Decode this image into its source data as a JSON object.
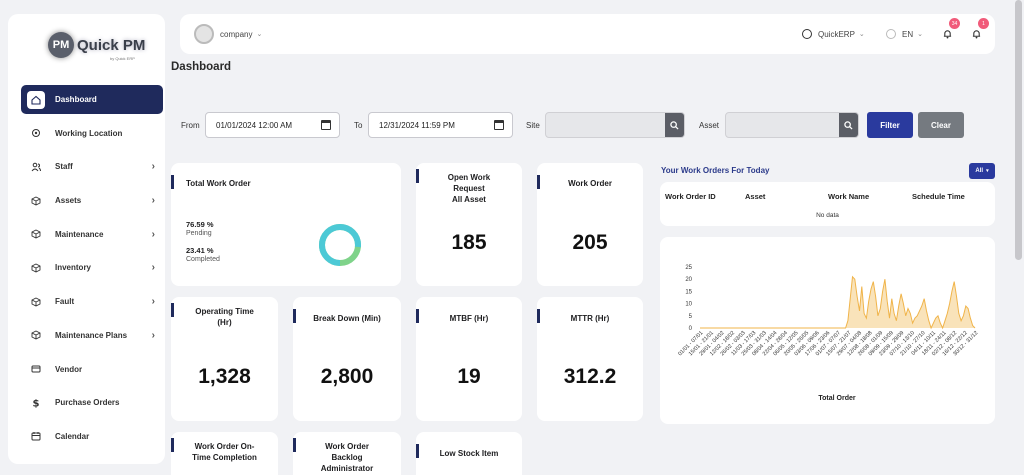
{
  "app": {
    "logo_text": "Quick PM",
    "logo_badge": "PM",
    "logo_sub": "by Quick ERP"
  },
  "sidebar": {
    "items": [
      {
        "label": "Dashboard",
        "icon": "home-icon",
        "active": true,
        "chevron": false
      },
      {
        "label": "Working Location",
        "icon": "target-icon",
        "chevron": false
      },
      {
        "label": "Staff",
        "icon": "users-icon",
        "chevron": true
      },
      {
        "label": "Assets",
        "icon": "cube-icon",
        "chevron": true
      },
      {
        "label": "Maintenance",
        "icon": "cube-icon",
        "chevron": true
      },
      {
        "label": "Inventory",
        "icon": "cube-icon",
        "chevron": true
      },
      {
        "label": "Fault",
        "icon": "cube-icon",
        "chevron": true
      },
      {
        "label": "Maintenance Plans",
        "icon": "cube-icon",
        "chevron": true
      },
      {
        "label": "Vendor",
        "icon": "card-icon",
        "chevron": false
      },
      {
        "label": "Purchase Orders",
        "icon": "dollar-icon",
        "chevron": false
      },
      {
        "label": "Calendar",
        "icon": "calendar-icon",
        "chevron": false
      }
    ]
  },
  "topbar": {
    "company": "company",
    "erp": "QuickERP",
    "lang": "EN",
    "notif_count_1": "34",
    "notif_count_2": "1"
  },
  "page_title": "Dashboard",
  "filters": {
    "from_label": "From",
    "from_value": "01/01/2024 12:00 AM",
    "to_label": "To",
    "to_value": "12/31/2024 11:59 PM",
    "site_label": "Site",
    "asset_label": "Asset",
    "filter_btn": "Filter",
    "clear_btn": "Clear"
  },
  "total_work_order": {
    "title": "Total Work Order",
    "pending_pct": "76.59 %",
    "pending_label": "Pending",
    "completed_pct": "23.41 %",
    "completed_label": "Completed",
    "pending_fraction": 0.7659
  },
  "stats": {
    "open_wr_title_1": "Open Work",
    "open_wr_title_2": "Request",
    "open_wr_title_3": "All Asset",
    "open_wr_value": "185",
    "work_order_title": "Work Order",
    "work_order_value": "205",
    "operating_time_title_1": "Operating Time",
    "operating_time_title_2": "(Hr)",
    "operating_time_value": "1,328",
    "breakdown_title": "Break Down (Min)",
    "breakdown_value": "2,800",
    "mtbf_title": "MTBF (Hr)",
    "mtbf_value": "19",
    "mttr_title": "MTTR (Hr)",
    "mttr_value": "312.2",
    "ontime_title_1": "Work Order On-",
    "ontime_title_2": "Time Completion",
    "backlog_title_1": "Work Order",
    "backlog_title_2": "Backlog",
    "backlog_title_3": "Administrator",
    "lowstock_title": "Low Stock Item"
  },
  "todays_orders": {
    "title": "Your Work Orders For Today",
    "filter": "All",
    "columns": [
      "Work Order ID",
      "Asset",
      "Work Name",
      "Schedule Time"
    ],
    "empty": "No data"
  },
  "colors": {
    "primary": "#1f2a5c",
    "filter_btn": "#2a3a9e",
    "clear_btn": "#757a80",
    "donut_pending": "#4cc9d6",
    "donut_completed": "#7fd38a",
    "area_fill": "#f7d9a3",
    "area_line": "#f0b44a"
  },
  "chart_data": {
    "type": "area",
    "xlabel": "Total Order",
    "ylabel": "",
    "ylim": [
      0,
      25
    ],
    "yticks": [
      0,
      5,
      10,
      15,
      20,
      25
    ],
    "categories": [
      "01/01 - 07/01",
      "15/01 - 21/01",
      "29/01 - 04/02",
      "12/02 - 18/02",
      "26/02 - 03/03",
      "11/03 - 17/03",
      "25/03 - 31/03",
      "08/04 - 14/04",
      "22/04 - 28/04",
      "06/05 - 12/05",
      "20/05 - 26/05",
      "03/06 - 09/06",
      "17/06 - 23/06",
      "01/07 - 07/07",
      "15/07 - 21/07",
      "29/07 - 04/08",
      "12/08 - 18/08",
      "26/08 - 01/09",
      "09/09 - 15/09",
      "23/09 - 29/09",
      "07/10 - 13/10",
      "21/10 - 27/10",
      "04/11 - 10/11",
      "18/11 - 24/11",
      "02/12 - 08/12",
      "16/12 - 22/12",
      "30/12 - 31/12"
    ],
    "values": [
      0,
      0,
      0,
      0,
      0,
      0,
      0,
      0,
      0,
      0,
      0,
      0,
      0,
      0,
      0,
      0,
      0,
      0,
      0,
      0,
      0,
      0,
      0,
      0,
      0,
      0,
      0,
      0,
      0,
      0,
      0,
      0,
      0,
      0,
      0,
      0,
      0,
      0,
      0,
      0,
      0,
      0,
      0,
      0,
      0,
      0,
      0,
      0,
      0,
      0,
      0,
      0,
      0,
      0,
      0,
      0,
      0,
      0,
      0,
      0,
      0,
      0,
      0,
      0,
      3,
      12,
      21,
      20,
      13,
      7,
      17,
      6,
      4,
      11,
      16,
      19,
      13,
      5,
      8,
      15,
      20,
      11,
      4,
      12,
      6,
      3,
      9,
      14,
      10,
      5,
      8,
      6,
      2,
      4,
      5,
      7,
      9,
      12,
      7,
      3,
      0,
      2,
      4,
      5,
      2,
      0,
      3,
      6,
      10,
      15,
      19,
      13,
      6,
      3,
      5,
      9,
      8,
      4,
      1,
      0
    ]
  }
}
